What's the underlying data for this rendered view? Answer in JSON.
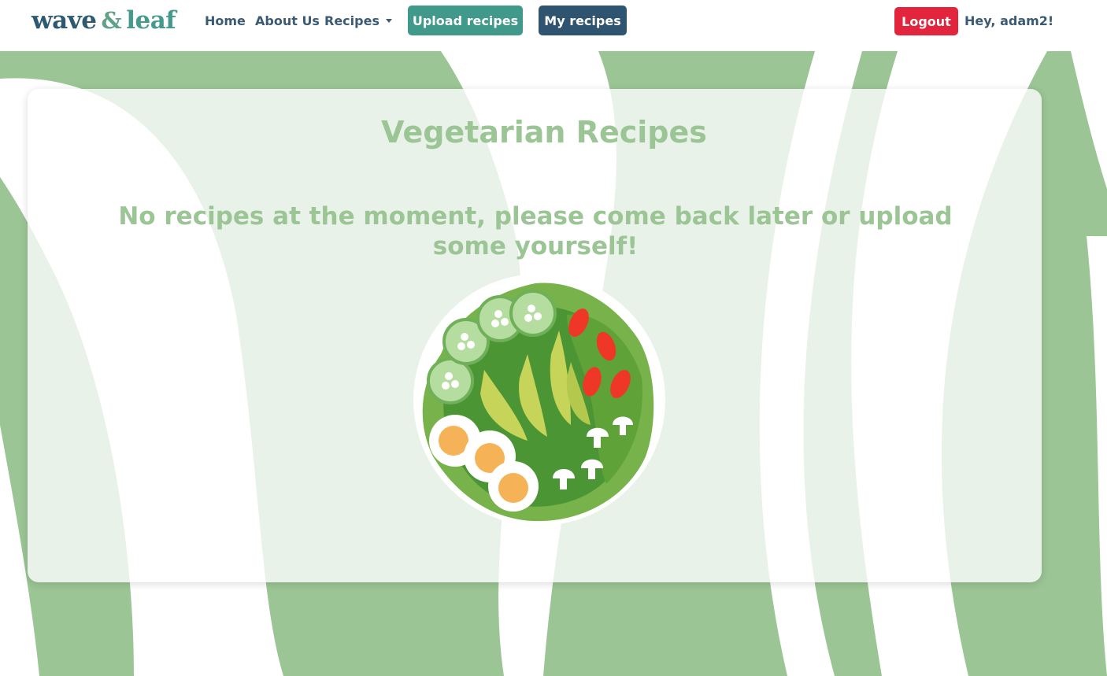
{
  "colors": {
    "stripe_green": "#9bc595",
    "brand_navy": "#2e5a71",
    "brand_teal": "#459a8b",
    "upload_button": "#40998a",
    "my_recipes_button": "#2f5470",
    "logout_button": "#e2243d",
    "heading_green": "#9bc595"
  },
  "nav": {
    "brand": {
      "word1": "wave",
      "amp": "&",
      "word2": "leaf"
    },
    "links": {
      "home": "Home",
      "about": "About Us",
      "recipes": "Recipes"
    },
    "upload_label": "Upload recipes",
    "my_recipes_label": "My recipes",
    "logout_label": "Logout",
    "greeting": "Hey, adam2!"
  },
  "main": {
    "title": "Vegetarian Recipes",
    "empty_message": "No recipes at the moment, please come back later or upload some yourself!",
    "illustration_icon": "salad-bowl-icon"
  }
}
